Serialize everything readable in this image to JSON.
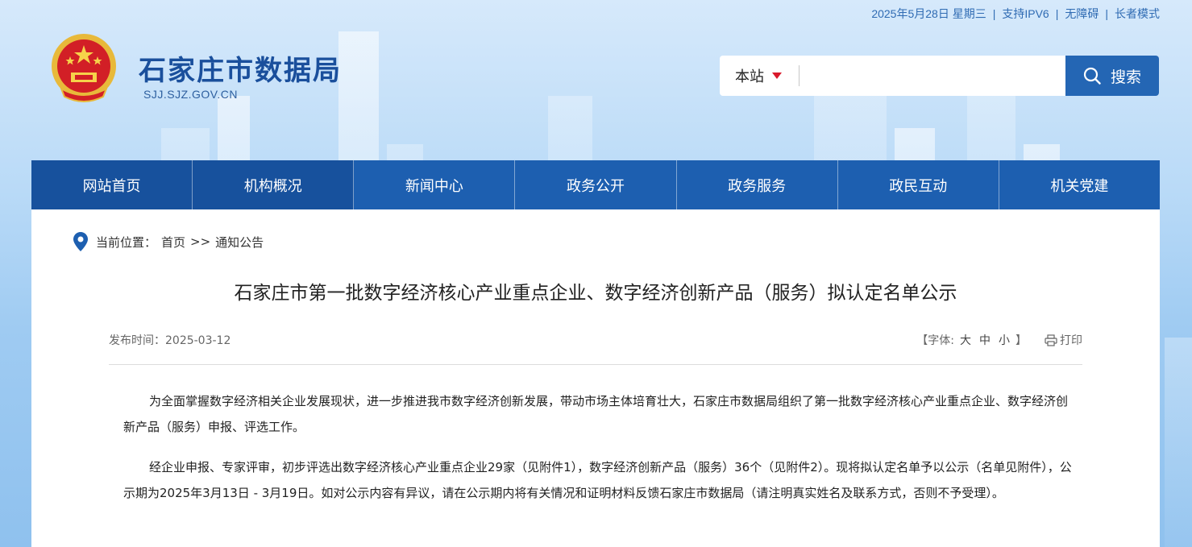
{
  "topbar": {
    "date": "2025年5月28日 星期三",
    "ipv6": "支持IPV6",
    "accessibility": "无障碍",
    "elder_mode": "长者模式"
  },
  "header": {
    "site_name": "石家庄市数据局",
    "domain": "SJJ.SJZ.GOV.CN"
  },
  "search": {
    "scope": "本站",
    "placeholder": "",
    "button_label": "搜索"
  },
  "nav": {
    "items": [
      {
        "label": "网站首页"
      },
      {
        "label": "机构概况"
      },
      {
        "label": "新闻中心"
      },
      {
        "label": "政务公开"
      },
      {
        "label": "政务服务"
      },
      {
        "label": "政民互动"
      },
      {
        "label": "机关党建"
      }
    ]
  },
  "breadcrumb": {
    "prefix": "当前位置：",
    "home": "首页",
    "sep": ">>",
    "current": "通知公告"
  },
  "article": {
    "title": "石家庄市第一批数字经济核心产业重点企业、数字经济创新产品（服务）拟认定名单公示",
    "publish_label": "发布时间：",
    "publish_date": "2025-03-12",
    "font_open": "【字体:",
    "font_large": "大",
    "font_medium": "中",
    "font_small": "小",
    "font_close": "】",
    "print_label": "打印",
    "paragraphs": [
      "为全面掌握数字经济相关企业发展现状，进一步推进我市数字经济创新发展，带动市场主体培育壮大，石家庄市数据局组织了第一批数字经济核心产业重点企业、数字经济创新产品（服务）申报、评选工作。",
      "经企业申报、专家评审，初步评选出数字经济核心产业重点企业29家（见附件1），数字经济创新产品（服务）36个（见附件2）。现将拟认定名单予以公示（名单见附件），公示期为2025年3月13日 - 3月19日。如对公示内容有异议，请在公示期内将有关情况和证明材料反馈石家庄市数据局（请注明真实姓名及联系方式，否则不予受理）。"
    ]
  },
  "colors": {
    "nav_bg": "#1d5fb0",
    "brand_blue": "#1a4f9c",
    "search_button": "#2466b4",
    "dropdown_triangle": "#d9192b"
  }
}
